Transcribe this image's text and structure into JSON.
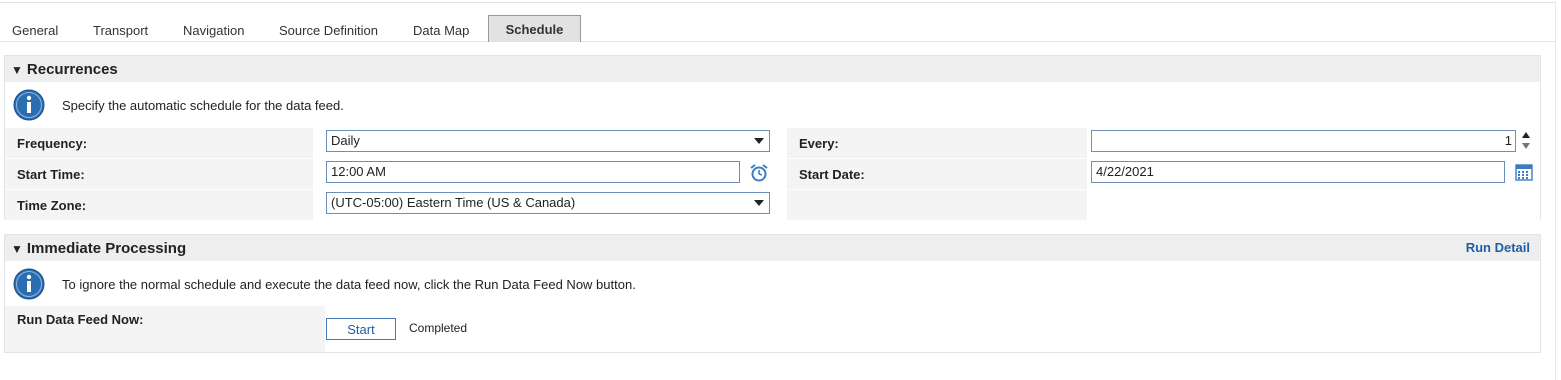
{
  "tabs": [
    {
      "label": "General"
    },
    {
      "label": "Transport"
    },
    {
      "label": "Navigation"
    },
    {
      "label": "Source Definition"
    },
    {
      "label": "Data Map"
    },
    {
      "label": "Schedule"
    }
  ],
  "active_tab": "Schedule",
  "recurrences": {
    "title": "Recurrences",
    "info": "Specify the automatic schedule for the data feed.",
    "frequency_label": "Frequency:",
    "frequency_value": "Daily",
    "every_label": "Every:",
    "every_value": "1",
    "start_time_label": "Start Time:",
    "start_time_value": "12:00 AM",
    "start_date_label": "Start Date:",
    "start_date_value": "4/22/2021",
    "time_zone_label": "Time Zone:",
    "time_zone_value": "(UTC-05:00) Eastern Time (US & Canada)"
  },
  "immediate": {
    "title": "Immediate Processing",
    "run_detail_link": "Run Detail",
    "info": "To ignore the normal schedule and execute the data feed now, click the Run Data Feed Now button.",
    "run_label": "Run Data Feed Now:",
    "start_button": "Start",
    "status": "Completed"
  },
  "colors": {
    "accent": "#1f5fa8",
    "field_border": "#6b8fb8",
    "header_bg": "#eeeeee",
    "info_icon": "#2a6db0"
  },
  "icons": [
    "info-icon",
    "alarm-clock-icon",
    "calendar-icon",
    "spinner-up-icon",
    "spinner-down-icon",
    "chevron-down-icon",
    "collapse-triangle-icon"
  ]
}
